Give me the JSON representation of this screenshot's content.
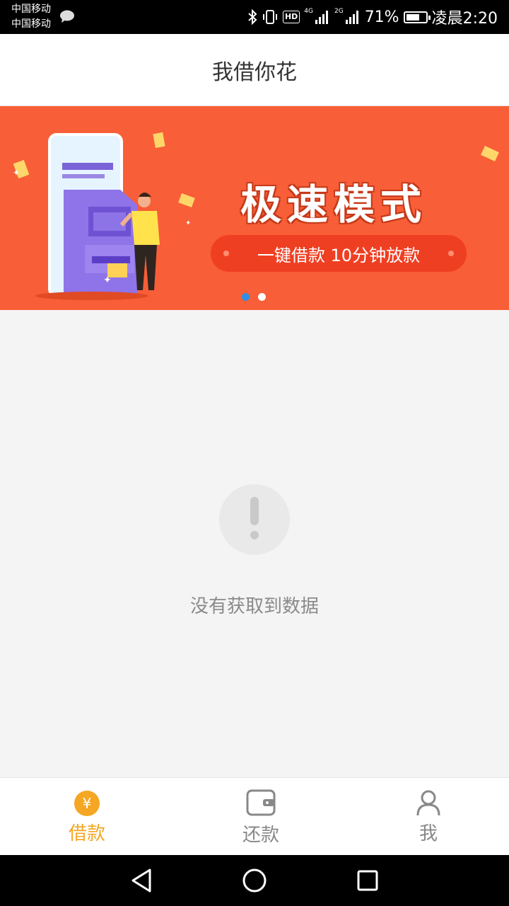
{
  "status_bar": {
    "carrier_1": "中国移动",
    "carrier_2": "中国移动",
    "net_1": "4G",
    "net_2": "2G",
    "battery": "71%",
    "battery_level": 0.71,
    "time": "凌晨2:20",
    "icons": [
      "chat-icon",
      "bluetooth-icon",
      "vibrate-icon",
      "hd-icon",
      "signal-icon",
      "battery-icon"
    ],
    "hd": "HD"
  },
  "header": {
    "title": "我借你花"
  },
  "banner": {
    "headline": "极速模式",
    "subtitle": "一键借款 10分钟放款",
    "background": "#f85e37",
    "slides": 2,
    "active_slide": 1,
    "illustration": "atm-phone-person-illustration"
  },
  "empty_state": {
    "icon": "exclamation-icon",
    "message": "没有获取到数据"
  },
  "tab_bar": {
    "active_color": "#f5a623",
    "inactive_color": "#888888",
    "tabs": [
      {
        "label": "借款",
        "icon": "yen-coin-icon",
        "active": true
      },
      {
        "label": "还款",
        "icon": "wallet-icon",
        "active": false
      },
      {
        "label": "我",
        "icon": "person-icon",
        "active": false
      }
    ]
  },
  "nav_bar": {
    "icons": [
      "back-icon",
      "home-icon",
      "recents-icon"
    ]
  }
}
